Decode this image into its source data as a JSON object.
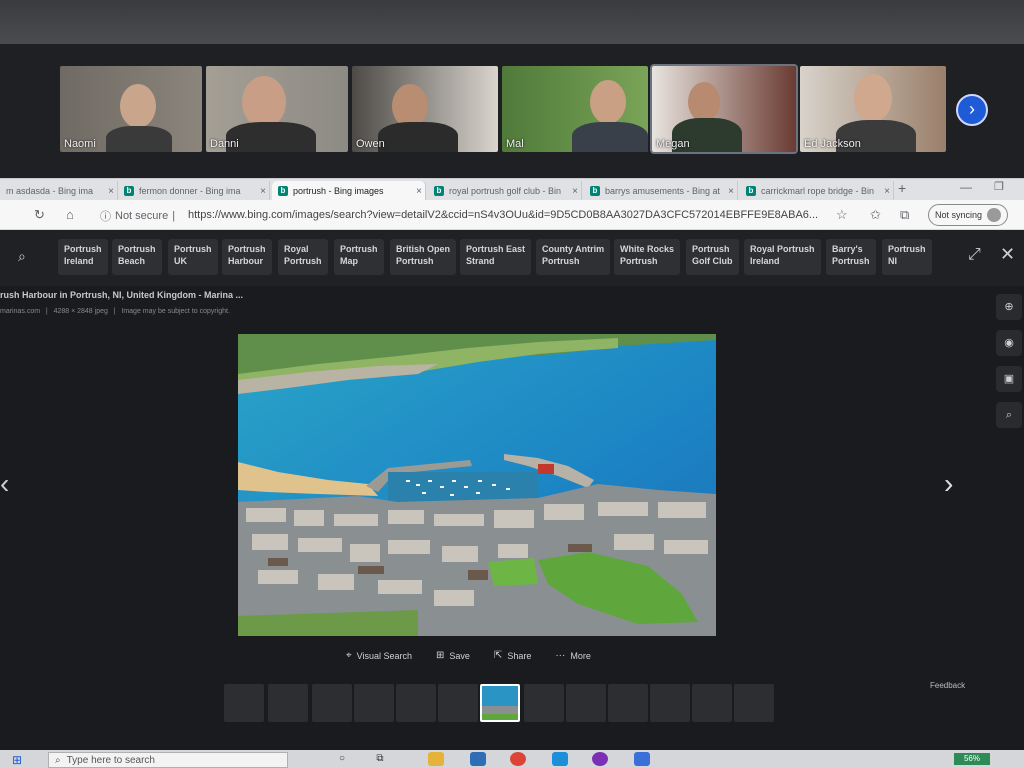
{
  "participants": [
    {
      "name": "Naomi"
    },
    {
      "name": "Danni"
    },
    {
      "name": "Owen"
    },
    {
      "name": "Mal"
    },
    {
      "name": "Megan"
    },
    {
      "name": "Ed Jackson"
    }
  ],
  "participants_next_icon": "chevron-right-icon",
  "tabs": [
    {
      "title": "m asdasda - Bing ima",
      "close": "×"
    },
    {
      "title": "fermon donner - Bing ima",
      "close": "×"
    },
    {
      "title": "portrush - Bing images",
      "close": "×"
    },
    {
      "title": "royal portrush golf club - Bin",
      "close": "×"
    },
    {
      "title": "barrys amusements - Bing at",
      "close": "×"
    },
    {
      "title": "carrickmarl rope bridge - Bin",
      "close": "×"
    }
  ],
  "new_tab": "+",
  "address_bar": {
    "security": "Not secure",
    "url": "https://www.bing.com/images/search?view=detailV2&ccid=nS4v3OUu&id=9D5CD0B8AA3027DA3CFC572014EBFFE9E8ABA6...",
    "sync": "Not syncing"
  },
  "related_searches": [
    {
      "line1": "Portrush",
      "line2": "Ireland"
    },
    {
      "line1": "Portrush",
      "line2": "Beach"
    },
    {
      "line1": "Portrush",
      "line2": "UK"
    },
    {
      "line1": "Portrush",
      "line2": "Harbour"
    },
    {
      "line1": "Royal",
      "line2": "Portrush"
    },
    {
      "line1": "Portrush",
      "line2": "Map"
    },
    {
      "line1": "British Open",
      "line2": "Portrush"
    },
    {
      "line1": "Portrush East",
      "line2": "Strand"
    },
    {
      "line1": "County Antrim",
      "line2": "Portrush"
    },
    {
      "line1": "White Rocks",
      "line2": "Portrush"
    },
    {
      "line1": "Portrush",
      "line2": "Golf Club"
    },
    {
      "line1": "Royal Portrush",
      "line2": "Ireland"
    },
    {
      "line1": "Barry's",
      "line2": "Portrush"
    },
    {
      "line1": "Portrush",
      "line2": "NI"
    }
  ],
  "image_info": {
    "title": "rush Harbour in Portrush, NI, United Kingdom - Marina ...",
    "source": "marinas.com",
    "dimensions": "4288 × 2848 jpeg",
    "copyright": "Image may be subject to copyright."
  },
  "actions": [
    {
      "label": "Visual Search",
      "icon": "visual-search-icon"
    },
    {
      "label": "Save",
      "icon": "save-icon"
    },
    {
      "label": "Share",
      "icon": "share-icon"
    },
    {
      "label": "More",
      "icon": "more-icon"
    }
  ],
  "feedback": "Feedback",
  "taskbar": {
    "search_placeholder": "Type here to search",
    "battery": "56%"
  }
}
